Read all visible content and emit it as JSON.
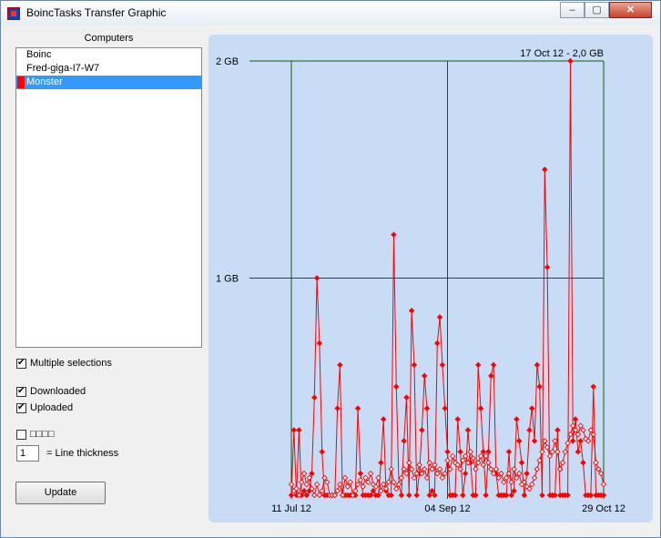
{
  "window": {
    "title": "BoincTasks Transfer Graphic",
    "minimize": "‒",
    "maximize": "▢",
    "close": "✕"
  },
  "computers": {
    "label": "Computers",
    "items": [
      {
        "label": "Boinc",
        "color": "",
        "selected": false
      },
      {
        "label": "Fred-giga-I7-W7",
        "color": "",
        "selected": false
      },
      {
        "label": "Monster",
        "color": "#ff0000",
        "selected": true
      }
    ]
  },
  "options": {
    "multiple_selections": {
      "label": "Multiple selections",
      "checked": true
    },
    "downloaded": {
      "label": "Downloaded",
      "checked": true
    },
    "uploaded": {
      "label": "Uploaded",
      "checked": true
    },
    "unlabeled": {
      "label": "□□□□",
      "checked": false
    },
    "line_thickness": {
      "value": "1",
      "label": "= Line thickness"
    }
  },
  "update_button": "Update",
  "chart_data": {
    "type": "line",
    "background": "#c9dcf5",
    "grid_color": "#0a5f0a",
    "y_ticks": [
      {
        "label": "2 GB",
        "value": 2.0
      },
      {
        "label": "1 GB",
        "value": 1.0
      }
    ],
    "x_ticks": [
      {
        "label": "11 Jul 12",
        "day": 0
      },
      {
        "label": "04 Sep 12",
        "day": 55
      },
      {
        "label": "29 Oct 12",
        "day": 110
      }
    ],
    "annotation": "17 Oct 12 - 2,0 GB",
    "xlim": [
      0,
      110
    ],
    "ylim": [
      0,
      2.0
    ],
    "series": [
      {
        "color": "#ff0000",
        "marker": "filled-diamond",
        "values": [
          0.0,
          0.3,
          0.0,
          0.3,
          0.0,
          0.02,
          0.0,
          0.02,
          0.1,
          0.45,
          1.0,
          0.7,
          0.2,
          0.0,
          0.0,
          0.0,
          0.0,
          0.0,
          0.4,
          0.6,
          0.0,
          0.0,
          0.0,
          0.0,
          0.0,
          0.0,
          0.4,
          0.1,
          0.0,
          0.0,
          0.0,
          0.0,
          0.02,
          0.0,
          0.0,
          0.15,
          0.35,
          0.02,
          0.0,
          0.0,
          1.2,
          0.5,
          0.05,
          0.0,
          0.25,
          0.45,
          0.0,
          0.85,
          0.6,
          0.0,
          0.1,
          0.3,
          0.55,
          0.4,
          0.0,
          0.02,
          0.0,
          0.7,
          0.82,
          0.6,
          0.4,
          0.2,
          0.0,
          0.0,
          0.0,
          0.35,
          0.2,
          0.0,
          0.1,
          0.3,
          0.15,
          0.0,
          0.0,
          0.6,
          0.4,
          0.2,
          0.0,
          0.2,
          0.55,
          0.6,
          0.1,
          0.0,
          0.0,
          0.0,
          0.0,
          0.2,
          0.0,
          0.02,
          0.35,
          0.25,
          0.15,
          0.0,
          0.1,
          0.3,
          0.4,
          0.25,
          0.6,
          0.5,
          0.0,
          1.5,
          1.05,
          0.0,
          0.0,
          0.0,
          0.3,
          0.0,
          0.0,
          0.0,
          0.0,
          2.0,
          0.25,
          0.35,
          0.2,
          0.25,
          0.15,
          0.0,
          0.0,
          0.0,
          0.5,
          0.0,
          0.0,
          0.0,
          0.0
        ]
      },
      {
        "color": "#ff0000",
        "marker": "hollow-diamond",
        "values": [
          0.05,
          0.02,
          0.03,
          0.0,
          0.06,
          0.1,
          0.05,
          0.08,
          0.03,
          0.0,
          0.05,
          0.0,
          0.02,
          0.08,
          0.06,
          0.0,
          0.0,
          0.0,
          0.02,
          0.05,
          0.0,
          0.08,
          0.04,
          0.06,
          0.0,
          0.02,
          0.05,
          0.07,
          0.04,
          0.08,
          0.06,
          0.1,
          0.05,
          0.04,
          0.08,
          0.02,
          0.05,
          0.03,
          0.06,
          0.12,
          0.06,
          0.03,
          0.05,
          0.08,
          0.12,
          0.1,
          0.15,
          0.12,
          0.08,
          0.1,
          0.14,
          0.1,
          0.12,
          0.08,
          0.15,
          0.12,
          0.14,
          0.1,
          0.12,
          0.08,
          0.1,
          0.16,
          0.12,
          0.18,
          0.15,
          0.14,
          0.12,
          0.16,
          0.18,
          0.15,
          0.2,
          0.17,
          0.12,
          0.15,
          0.18,
          0.14,
          0.18,
          0.15,
          0.12,
          0.1,
          0.12,
          0.08,
          0.1,
          0.06,
          0.08,
          0.1,
          0.06,
          0.12,
          0.08,
          0.1,
          0.05,
          0.06,
          0.04,
          0.03,
          0.05,
          0.08,
          0.12,
          0.16,
          0.2,
          0.25,
          0.22,
          0.18,
          0.2,
          0.25,
          0.2,
          0.12,
          0.15,
          0.2,
          0.24,
          0.28,
          0.32,
          0.3,
          0.28,
          0.32,
          0.3,
          0.26,
          0.25,
          0.3,
          0.28,
          0.15,
          0.12,
          0.1,
          0.05
        ]
      }
    ]
  }
}
